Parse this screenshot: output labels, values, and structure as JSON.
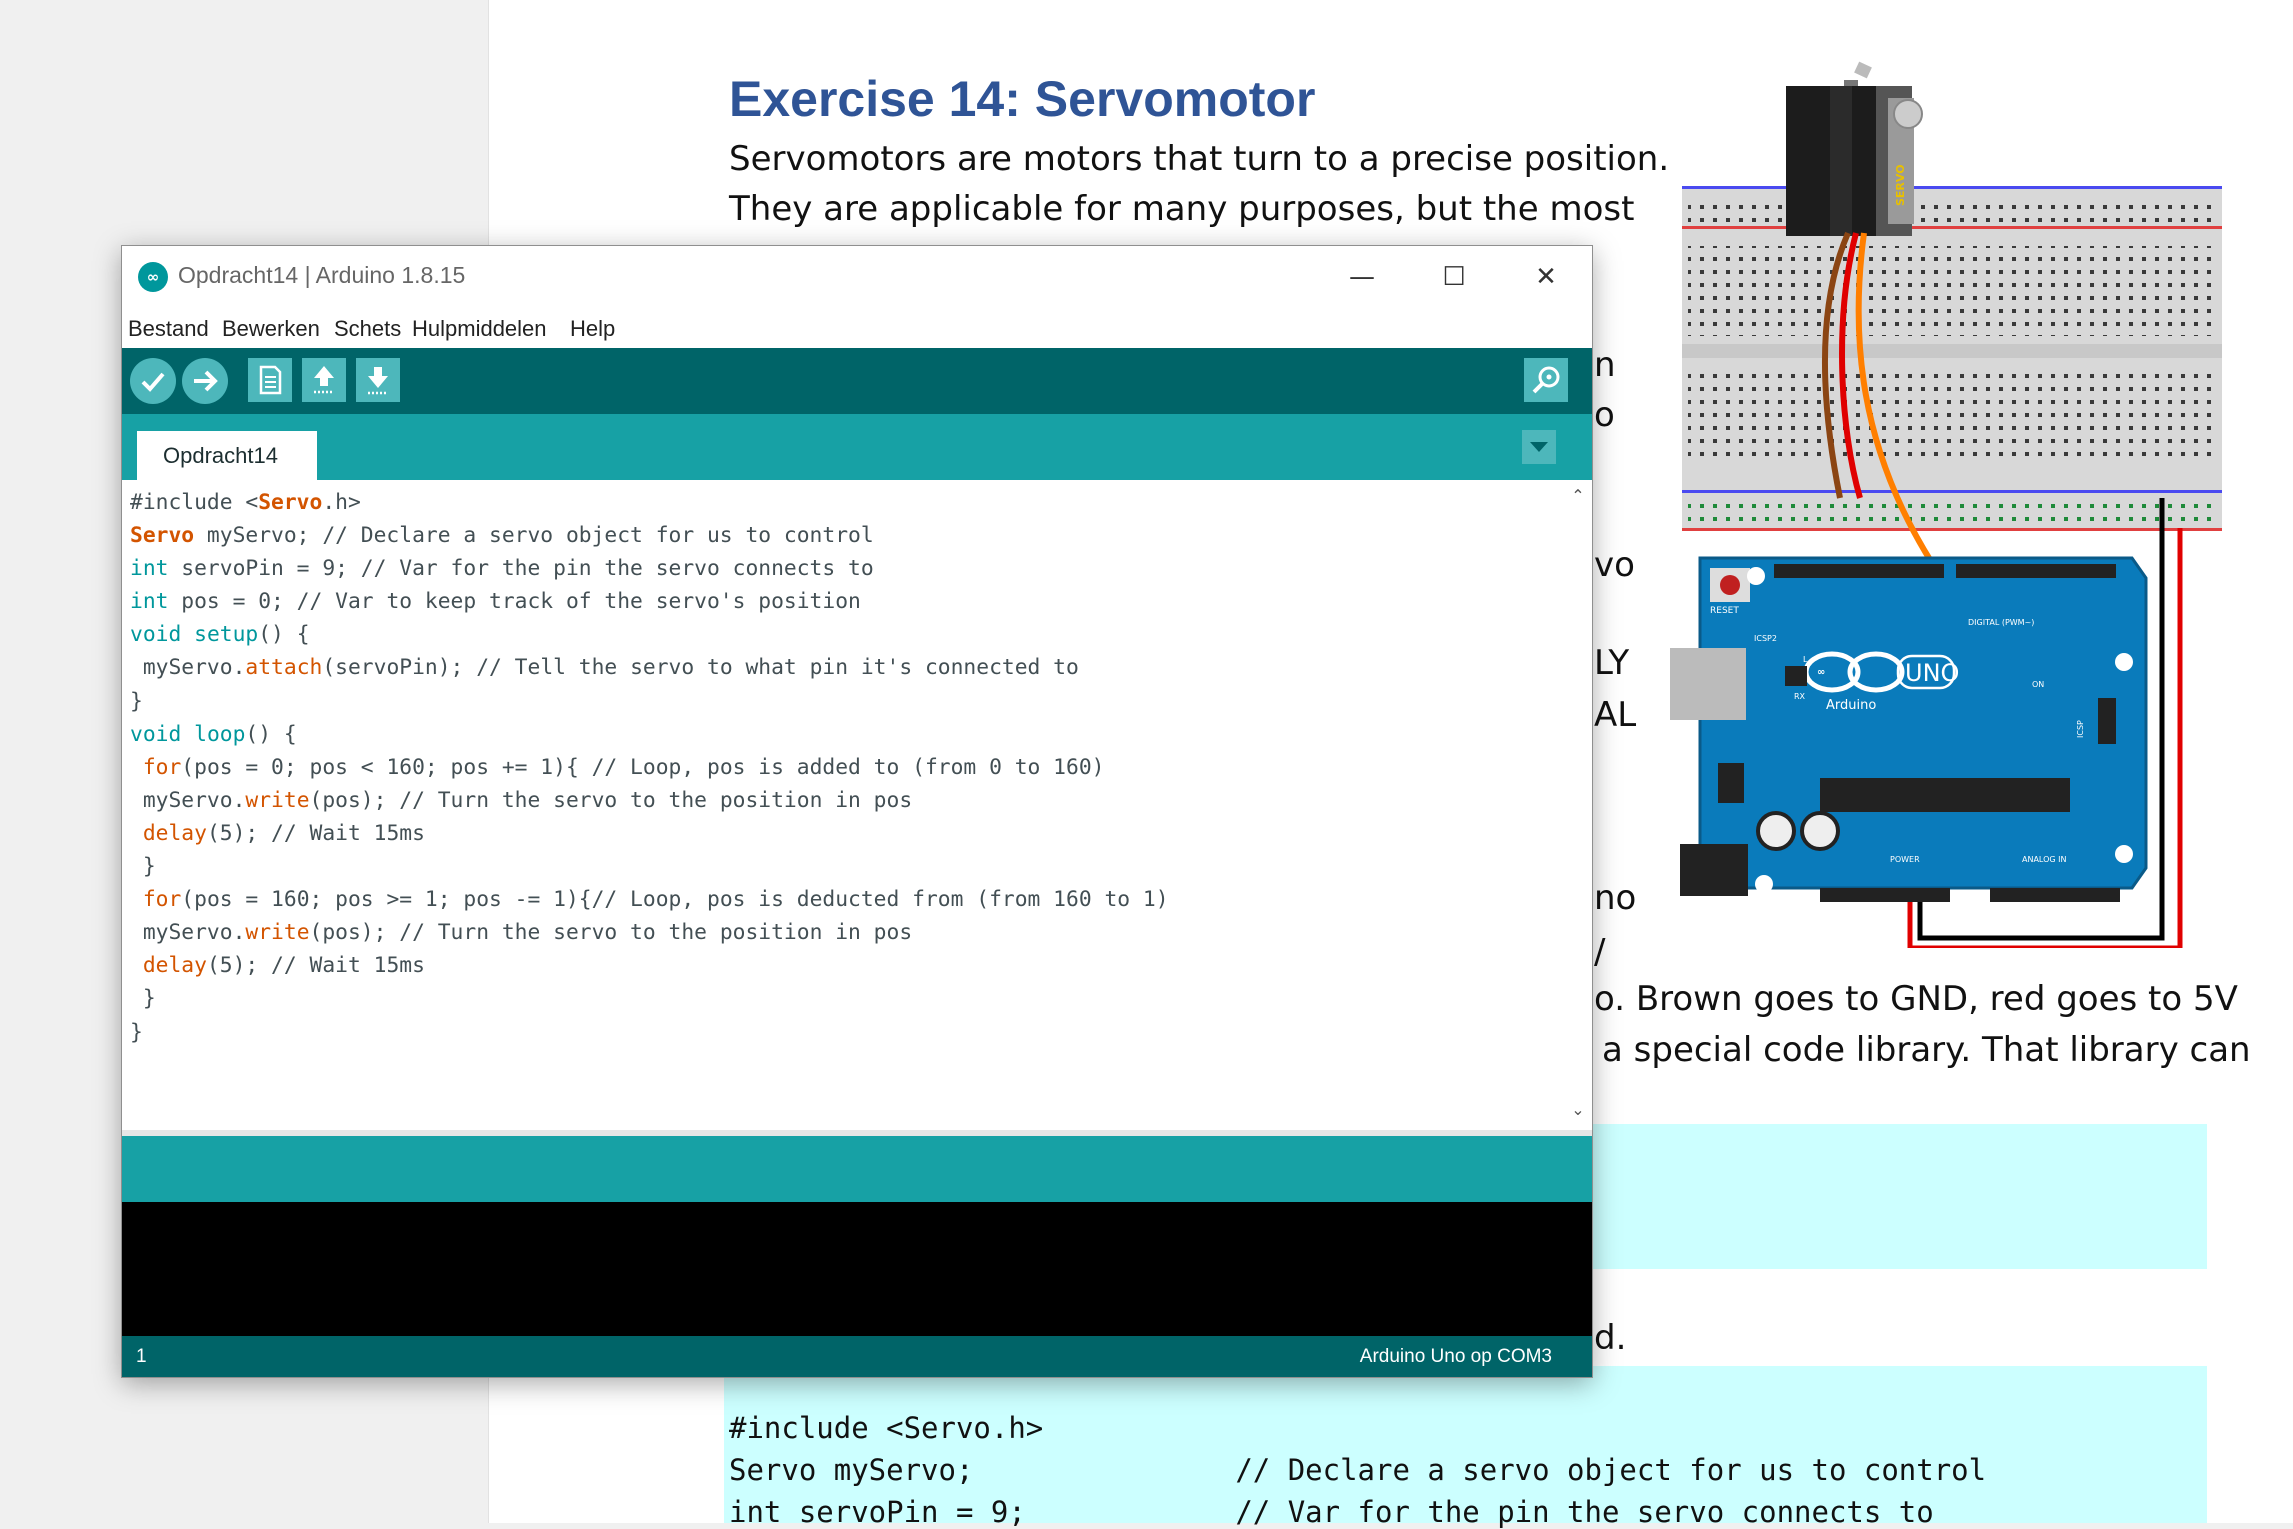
{
  "document": {
    "title": "Exercise 14: Servomotor",
    "lines": [
      "Servomotors are motors that turn to a precise position.",
      "They are applicable for many purposes, but the most"
    ],
    "right_fragments": [
      "n",
      "o",
      "vo",
      "LY",
      "AL",
      "no",
      "/"
    ],
    "lower_lines": [
      "o. Brown goes to GND, red goes to 5V",
      "a special code library. That library can"
    ],
    "end_fragment": "d.",
    "code_lines": [
      "#include <Servo.h>",
      "Servo myServo;               // Declare a servo object for us to control",
      "int servoPin = 9;            // Var for the pin the servo connects to"
    ],
    "image_labels": {
      "servo": "SERVO",
      "reset": "RESET",
      "uno": "UNO",
      "arduino": "Arduino",
      "digital": "DIGITAL (PWM~)",
      "power": "POWER",
      "analog": "ANALOG IN",
      "icsp2": "ICSP2",
      "icsp": "ICSP",
      "tx": "TX",
      "rx": "RX",
      "l": "L",
      "on": "ON"
    }
  },
  "ide": {
    "window_title": "Opdracht14 | Arduino 1.8.15",
    "window_controls": {
      "minimize": "—",
      "maximize": "☐",
      "close": "✕"
    },
    "menu": [
      "Bestand",
      "Bewerken",
      "Schets",
      "Hulpmiddelen",
      "Help"
    ],
    "toolbar_icons": [
      "verify-icon",
      "upload-icon",
      "new-icon",
      "open-icon",
      "save-icon",
      "serial-monitor-icon"
    ],
    "tab_label": "Opdracht14",
    "code_lines": [
      "#include <Servo.h>",
      "Servo myServo; // Declare a servo object for us to control",
      "int servoPin = 9; // Var for the pin the servo connects to",
      "int pos = 0; // Var to keep track of the servo's position",
      "void setup() {",
      " myServo.attach(servoPin); // Tell the servo to what pin it's connected to",
      "}",
      "void loop() {",
      " for(pos = 0; pos < 160; pos += 1){ // Loop, pos is added to (from 0 to 160)",
      " myServo.write(pos); // Turn the servo to the position in pos",
      " delay(5); // Wait 15ms",
      " }",
      " for(pos = 160; pos >= 1; pos -= 1){// Loop, pos is deducted from (from 160 to 1)",
      " myServo.write(pos); // Turn the servo to the position in pos",
      " delay(5); // Wait 15ms",
      " }",
      "}"
    ],
    "status_line": "1",
    "status_board": "Arduino Uno op COM3",
    "colors": {
      "toolbar": "#006468",
      "tabbar": "#17a1a5",
      "button": "#4db7bb",
      "keyword": "#00979c",
      "class": "#d35400"
    }
  }
}
